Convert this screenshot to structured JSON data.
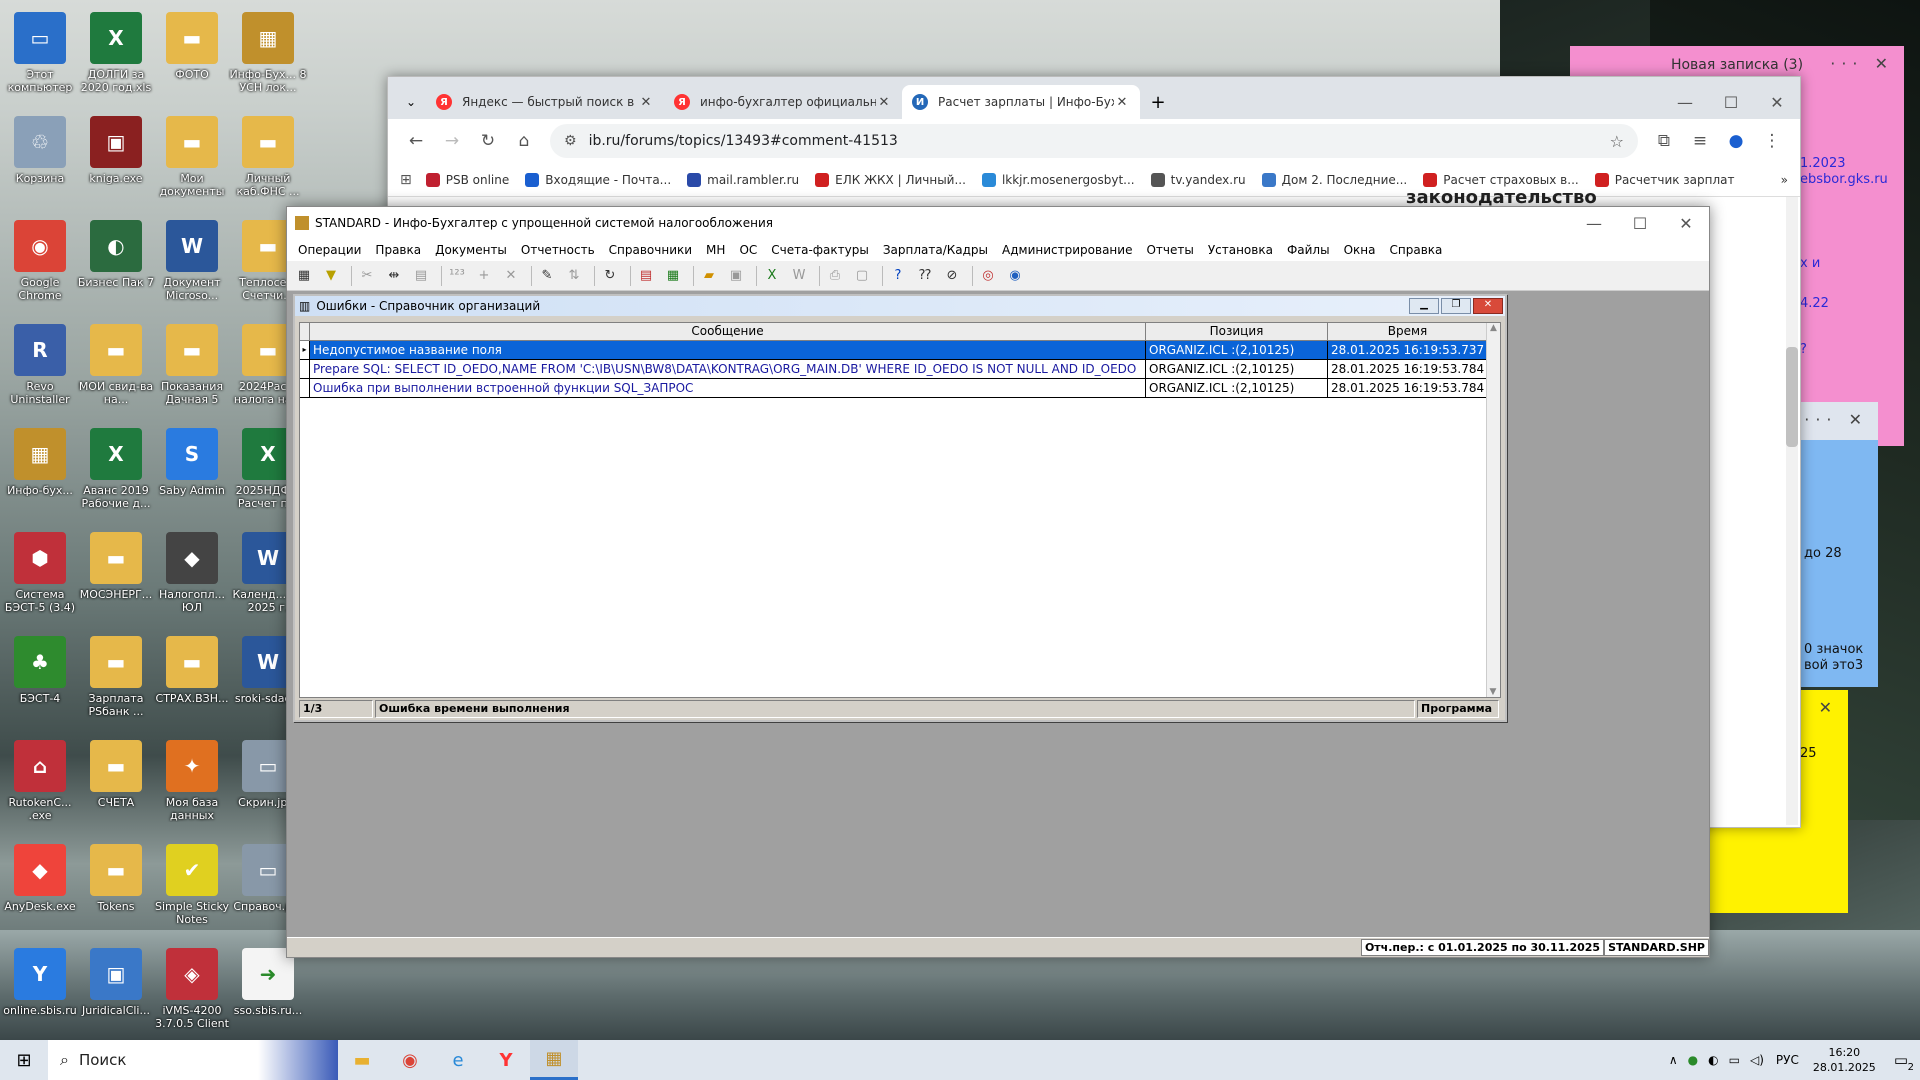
{
  "desktop": {
    "icons": [
      {
        "label": "Этот компьютер",
        "color": "#2a6fc9",
        "glyph": "▭"
      },
      {
        "label": "ДОЛГИ за 2020 год.xls",
        "color": "#1f7a3e",
        "glyph": "X"
      },
      {
        "label": "ФОТО",
        "color": "#e6b84a",
        "glyph": "▬"
      },
      {
        "label": "Инфо-Бух... 8 УСН лок...",
        "color": "#c0902c",
        "glyph": "▦"
      },
      {
        "label": "Корзина",
        "color": "#8aa0b8",
        "glyph": "♲"
      },
      {
        "label": "kniga.exe",
        "color": "#8a2020",
        "glyph": "▣"
      },
      {
        "label": "Мои документы",
        "color": "#e6b84a",
        "glyph": "▬"
      },
      {
        "label": "Личный каб.ФНС ...",
        "color": "#e6b84a",
        "glyph": "▬"
      },
      {
        "label": "Google Chrome",
        "color": "#db4437",
        "glyph": "◉"
      },
      {
        "label": "Бизнес Пак 7",
        "color": "#2b6b3f",
        "glyph": "◐"
      },
      {
        "label": "Документ Microso...",
        "color": "#2b579a",
        "glyph": "W"
      },
      {
        "label": "Теплосе... Счетчи...",
        "color": "#e6b84a",
        "glyph": "▬"
      },
      {
        "label": "Revo Uninstaller",
        "color": "#3a5fa8",
        "glyph": "R"
      },
      {
        "label": "МОИ свид-ва на...",
        "color": "#e6b84a",
        "glyph": "▬"
      },
      {
        "label": "Показания Дачная 5",
        "color": "#e6b84a",
        "glyph": "▬"
      },
      {
        "label": "2024Рас... налога на...",
        "color": "#e6b84a",
        "glyph": "▬"
      },
      {
        "label": "Инфо-бух...",
        "color": "#c0902c",
        "glyph": "▦"
      },
      {
        "label": "Аванс 2019 Рабочие д...",
        "color": "#1f7a3e",
        "glyph": "X"
      },
      {
        "label": "Saby Admin",
        "color": "#2a7be0",
        "glyph": "S"
      },
      {
        "label": "2025НДФ... Расчет п...",
        "color": "#1f7a3e",
        "glyph": "X"
      },
      {
        "label": "Система БЭСТ-5 (3.4)",
        "color": "#c0303a",
        "glyph": "⬢"
      },
      {
        "label": "МОСЭНЕРГ...",
        "color": "#e6b84a",
        "glyph": "▬"
      },
      {
        "label": "Налогопл... ЮЛ",
        "color": "#444",
        "glyph": "◆"
      },
      {
        "label": "Календ... на 2025 г.",
        "color": "#2b579a",
        "glyph": "W"
      },
      {
        "label": "БЭСТ-4",
        "color": "#2e8b2e",
        "glyph": "♣"
      },
      {
        "label": "Зарплата PSбанк ...",
        "color": "#e6b84a",
        "glyph": "▬"
      },
      {
        "label": "СТРАХ.ВЗН...",
        "color": "#e6b84a",
        "glyph": "▬"
      },
      {
        "label": "sroki-sdac...",
        "color": "#2b579a",
        "glyph": "W"
      },
      {
        "label": "RutokenC... .exe",
        "color": "#c0303a",
        "glyph": "⌂"
      },
      {
        "label": "СЧЕТА",
        "color": "#e6b84a",
        "glyph": "▬"
      },
      {
        "label": "Моя база данных",
        "color": "#e07020",
        "glyph": "✦"
      },
      {
        "label": "Скрин.jp...",
        "color": "#8898a8",
        "glyph": "▭"
      },
      {
        "label": "AnyDesk.exe",
        "color": "#ef443b",
        "glyph": "◆"
      },
      {
        "label": "Tokens",
        "color": "#e6b84a",
        "glyph": "▬"
      },
      {
        "label": "Simple Sticky Notes",
        "color": "#e0d020",
        "glyph": "✔"
      },
      {
        "label": "Справоч.р...",
        "color": "#8898a8",
        "glyph": "▭"
      },
      {
        "label": "online.sbis.ru",
        "color": "#2a7be0",
        "glyph": "Y"
      },
      {
        "label": "JuridicalCli...",
        "color": "#3a78c8",
        "glyph": "▣"
      },
      {
        "label": "iVMS-4200 3.7.0.5 Client",
        "color": "#c0303a",
        "glyph": "◈"
      },
      {
        "label": "sso.sbis.ru...",
        "color": "#f4f4f4",
        "glyph": "➜"
      }
    ]
  },
  "sticky_notes": {
    "pink": {
      "title": "Новая записка (3)",
      "lines": [
        "1.2023",
        "ebsbor.gks.ru",
        "х и",
        "4.22",
        "?"
      ]
    },
    "blue": {
      "lines": [
        "до 28",
        "0 значок",
        "вой это3"
      ]
    },
    "yellow": {
      "lines": [
        "25"
      ]
    }
  },
  "browser": {
    "tabs": [
      {
        "title": "Яндекс — быстрый поиск в ин..."
      },
      {
        "title": "инфо-бухгалтер официальный..."
      },
      {
        "title": "Расчет зарплаты | Инфо-Бухга..."
      }
    ],
    "url": "ib.ru/forums/topics/13493#comment-41513",
    "bookmarks": [
      "PSB online",
      "Входящие - Почта...",
      "mail.rambler.ru",
      "ЕЛК ЖКХ | Личный...",
      "lkkjr.mosenergosbyt...",
      "tv.yandex.ru",
      "Дом 2. Последние...",
      "Расчет страховых в...",
      "Расчетчик зарплат"
    ],
    "page_heading": "законодательство"
  },
  "app": {
    "title": "STANDARD - Инфо-Бухгалтер с упрощенной системой налогообложения",
    "menu": [
      "Операции",
      "Правка",
      "Документы",
      "Отчетность",
      "Справочники",
      "МН",
      "ОС",
      "Счета-фактуры",
      "Зарплата/Кадры",
      "Администрирование",
      "Отчеты",
      "Установка",
      "Файлы",
      "Окна",
      "Справка"
    ],
    "status_period": "Отч.пер.: с 01.01.2025 по 30.11.2025",
    "status_file": "STANDARD.SHP",
    "errors_window": {
      "title": "Ошибки - Справочник организаций",
      "columns": [
        "Сообщение",
        "Позиция",
        "Время"
      ],
      "rows": [
        {
          "message": "Недопустимое название поля",
          "position": "ORGANIZ.ICL :(2,10125)",
          "time": "28.01.2025 16:19:53.737"
        },
        {
          "message": "Prepare SQL: SELECT ID_OEDO,NAME FROM 'C:\\IB\\USN\\BW8\\DATA\\KONTRAG\\ORG_MAIN.DB' WHERE  ID_OEDO IS NOT NULL AND ID_OEDO",
          "position": "ORGANIZ.ICL :(2,10125)",
          "time": "28.01.2025 16:19:53.784"
        },
        {
          "message": "Ошибка при выполнении встроенной функции SQL_ЗАПРОС",
          "position": "ORGANIZ.ICL :(2,10125)",
          "time": "28.01.2025 16:19:53.784"
        }
      ],
      "status_count": "1/3",
      "status_text": "Ошибка времени выполнения",
      "status_right": "Программа"
    }
  },
  "taskbar": {
    "search_placeholder": "Поиск",
    "lang": "РУС",
    "time": "16:20",
    "date": "28.01.2025",
    "notif_count": "2"
  }
}
